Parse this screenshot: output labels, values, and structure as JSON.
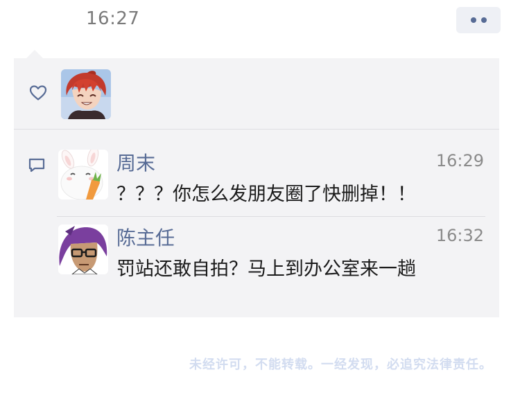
{
  "header": {
    "timestamp": "16:27",
    "more_icon": "ellipsis-icon"
  },
  "likes": {
    "icon": "heart-icon",
    "users": [
      {
        "avatar": "red-haired-anime-avatar"
      }
    ]
  },
  "comments": {
    "icon": "comment-icon",
    "items": [
      {
        "name": "周末",
        "time": "16:29",
        "text": "？？？你怎么发朋友圈了快删掉！！",
        "avatar": "bunny-carrot-avatar"
      },
      {
        "name": "陈主任",
        "time": "16:32",
        "text": "罚站还敢自拍？马上到办公室来一趟",
        "avatar": "purple-haired-glasses-avatar"
      }
    ]
  },
  "watermark": "未经许可，不能转载。一经发现，必追究法律责任。",
  "colors": {
    "accent": "#576b95",
    "panel_bg": "#f3f3f5",
    "divider": "#dedee2"
  }
}
